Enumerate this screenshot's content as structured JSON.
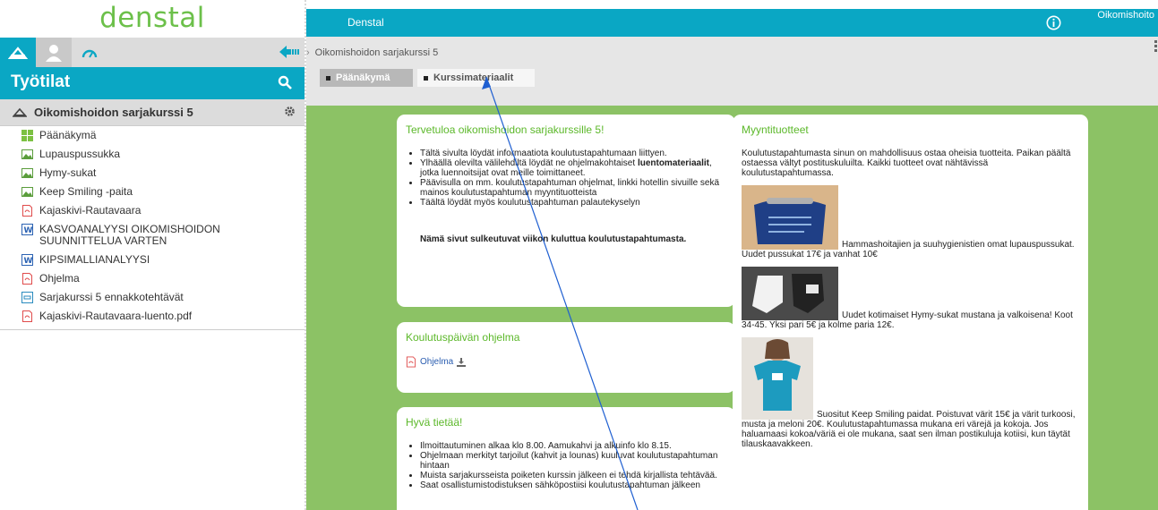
{
  "logo": "denstal",
  "sidebar": {
    "workspace_title": "Työtilat",
    "course_name": "Oikomishoidon sarjakurssi 5",
    "items": [
      {
        "label": "Päänäkymä",
        "icon": "grid-icon"
      },
      {
        "label": "Lupauspussukka",
        "icon": "image-icon"
      },
      {
        "label": "Hymy-sukat",
        "icon": "image-icon"
      },
      {
        "label": "Keep Smiling -paita",
        "icon": "image-icon"
      },
      {
        "label": "Kajaskivi-Rautavaara",
        "icon": "pdf-icon"
      },
      {
        "label": "KASVOANALYYSI OIKOMISHOIDON SUUNNITTELUA VARTEN",
        "icon": "word-icon"
      },
      {
        "label": "KIPSIMALLIANALYYSI",
        "icon": "word-icon"
      },
      {
        "label": "Ohjelma",
        "icon": "pdf-icon"
      },
      {
        "label": "Sarjakurssi 5 ennakkotehtävät",
        "icon": "form-icon"
      },
      {
        "label": "Kajaskivi-Rautavaara-luento.pdf",
        "icon": "pdf-icon"
      }
    ]
  },
  "topbar": {
    "brand": "Denstal",
    "user": "Oikomishoito"
  },
  "breadcrumb": "Oikomishoidon sarjakurssi 5",
  "tabs": {
    "main": "Päänäkymä",
    "materials": "Kurssimateriaalit"
  },
  "welcome": {
    "title": "Tervetuloa oikomishoidon sarjakurssille 5!",
    "bullets": [
      "Tältä sivulta löydät informaatiota koulutustapahtumaan liittyen.",
      "Päävisulla on mm. koulutustapahtuman ohjelmat, linkki hotellin sivuille sekä mainos koulutustapahtuman myyntituotteista",
      "Täältä löydät myös koulutustapahtuman palautekyselyn"
    ],
    "bullet2_a": "Ylhäällä olevilta välilehdiltä löydät ne ohjelmakohtaiset ",
    "bullet2_bold": "luentomateriaalit",
    "bullet2_b": ", jotka luennoitsijat ovat meille toimittaneet.",
    "closing": "Nämä sivut sulkeutuvat viikon kuluttua koulutustapahtumasta."
  },
  "program": {
    "title": "Koulutuspäivän ohjelma",
    "link": "Ohjelma"
  },
  "goodtoknow": {
    "title": "Hyvä tietää!",
    "bullets": [
      "Ilmoittautuminen alkaa klo 8.00. Aamukahvi ja alkuinfo klo 8.15.",
      "Ohjelmaan merkityt tarjoilut (kahvit ja lounas) kuuluvat koulutustapahtuman hintaan",
      "Muista sarjakursseista poiketen kurssin jälkeen ei tehdä kirjallista tehtävää.",
      "Saat osallistumistodistuksen sähköpostiisi koulutustapahtuman jälkeen"
    ]
  },
  "shop": {
    "title": "Myyntituotteet",
    "intro": "Koulutustapahtumasta sinun on mahdollisuus ostaa oheisia tuotteita. Paikan päältä ostaessa vältyt postituskuluilta. Kaikki tuotteet ovat nähtävissä koulutustapahtumassa.",
    "product1": "Hammashoitajien ja suuhygienistien omat lupauspussukat. Uudet pussukat 17€ ja vanhat 10€",
    "product2": "Uudet kotimaiset Hymy-sukat mustana ja valkoisena! Koot 34-45. Yksi pari 5€ ja kolme paria 12€.",
    "product3": "Suositut Keep Smiling paidat. Poistuvat värit 15€ ja värit turkoosi, musta ja meloni 20€. Koulutustapahtumassa mukana eri värejä ja kokoja. Jos haluamaasi kokoa/väriä ei ole mukana, saat sen ilman postikuluja kotiisi, kun täytät tilauskaavakkeen."
  },
  "colors": {
    "accent": "#0aa7c4",
    "green_bg": "#8cc265",
    "title_green": "#5cb82a",
    "logo_green": "#6cc04a"
  }
}
